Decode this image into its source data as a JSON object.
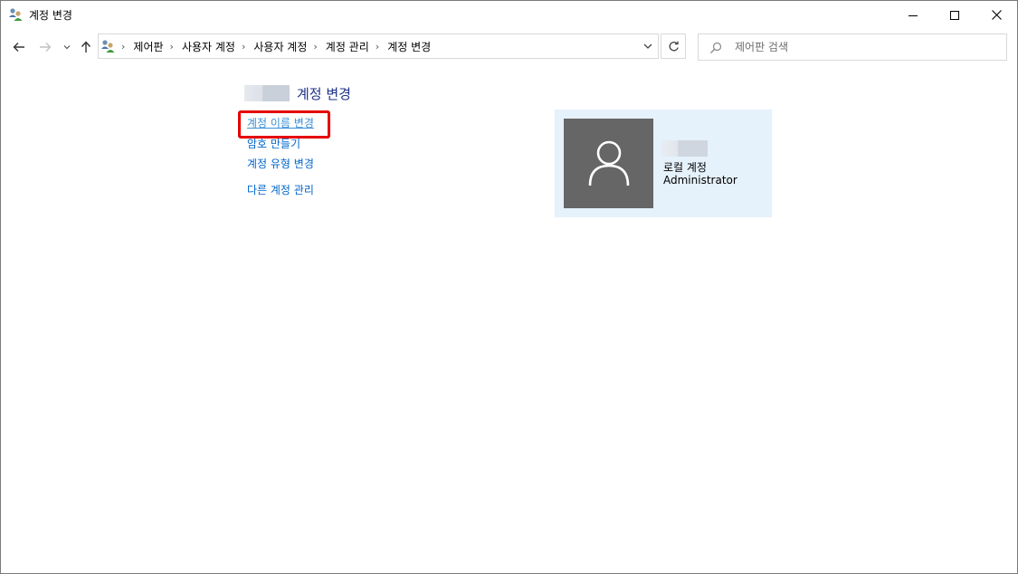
{
  "window": {
    "title": "계정 변경"
  },
  "address_bar": {
    "breadcrumbs": [
      "제어판",
      "사용자 계정",
      "사용자 계정",
      "계정 관리",
      "계정 변경"
    ]
  },
  "search": {
    "placeholder": "제어판 검색"
  },
  "content": {
    "page_title": "계정 변경",
    "links": {
      "rename": "계정 이름 변경",
      "password": "암호 만들기",
      "change_type": "계정 유형 변경",
      "manage_other": "다른 계정 관리"
    }
  },
  "account_card": {
    "account_type": "로컬 계정",
    "role": "Administrator"
  },
  "colors": {
    "title_blue": "#1e3287",
    "link_blue": "#0066cc",
    "highlight_red": "#e60000",
    "card_bg": "#e5f1fb",
    "avatar_bg": "#666666"
  },
  "icons": [
    "users-icon",
    "minimize-icon",
    "maximize-icon",
    "close-icon",
    "back-arrow-icon",
    "forward-arrow-icon",
    "recent-dropdown-icon",
    "up-arrow-icon",
    "chevron-down-icon",
    "refresh-icon",
    "search-icon",
    "user-silhouette-icon"
  ]
}
